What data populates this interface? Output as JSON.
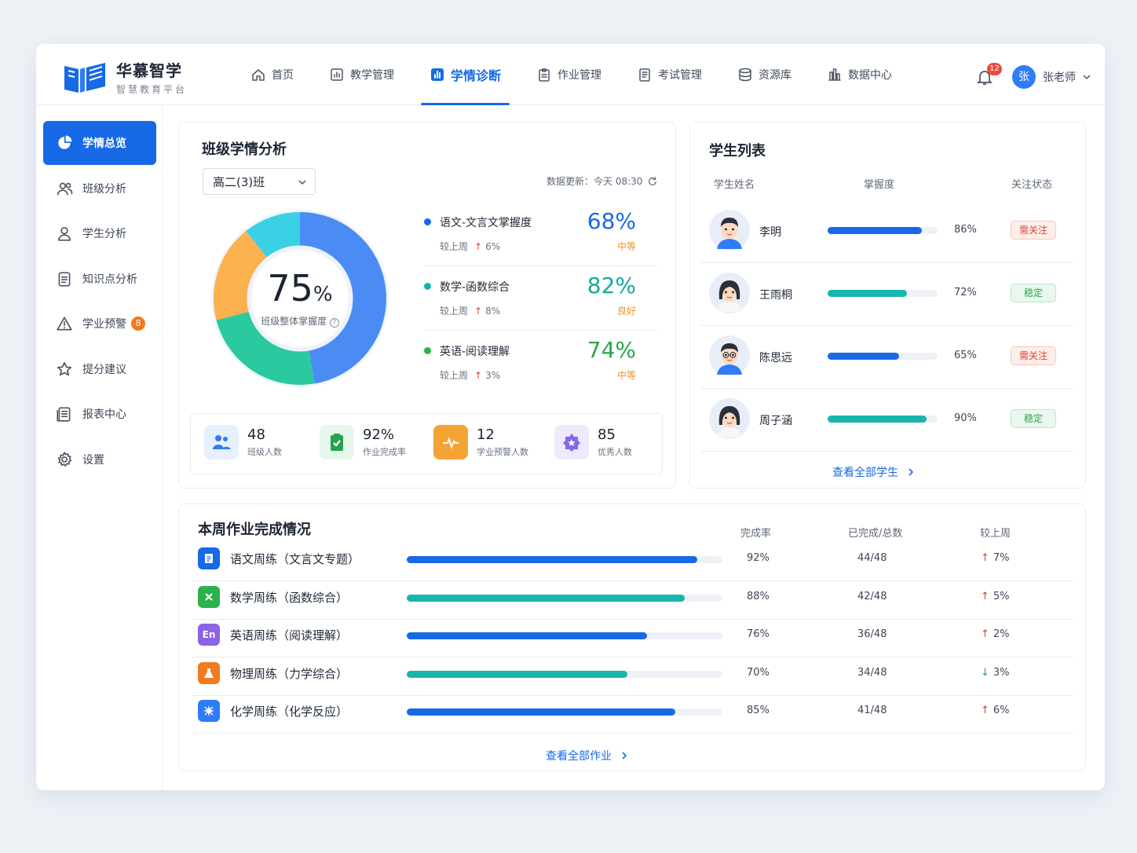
{
  "brand": {
    "title": "华慕智学",
    "subtitle": "智慧教育平台"
  },
  "nav": [
    {
      "label": "首页",
      "icon": "home-icon"
    },
    {
      "label": "教学管理",
      "icon": "chart-board-icon"
    },
    {
      "label": "学情诊断",
      "icon": "bar-chart-icon",
      "active": true
    },
    {
      "label": "作业管理",
      "icon": "clipboard-icon"
    },
    {
      "label": "考试管理",
      "icon": "exam-icon"
    },
    {
      "label": "资源库",
      "icon": "database-icon"
    },
    {
      "label": "数据中心",
      "icon": "columns-icon"
    }
  ],
  "notifications": {
    "count": "12"
  },
  "user": {
    "avatar_char": "张",
    "name": "张老师"
  },
  "sidebar": [
    {
      "label": "学情总览",
      "icon": "pie-icon",
      "active": true
    },
    {
      "label": "班级分析",
      "icon": "users-icon"
    },
    {
      "label": "学生分析",
      "icon": "user-icon"
    },
    {
      "label": "知识点分析",
      "icon": "document-icon"
    },
    {
      "label": "学业预警",
      "icon": "warning-icon",
      "badge": "8"
    },
    {
      "label": "提分建议",
      "icon": "star-outline-icon"
    },
    {
      "label": "报表中心",
      "icon": "report-icon"
    },
    {
      "label": "设置",
      "icon": "gear-icon"
    }
  ],
  "analysis": {
    "title": "班级学情分析",
    "class_select": "高二(3)班",
    "update_label": "数据更新：",
    "update_time": "今天 08:30",
    "overall_value": "75",
    "overall_unit": "%",
    "overall_label": "班级整体掌握度",
    "donut": [
      {
        "value": 44,
        "color": "#4a8cf4"
      },
      {
        "value": 22,
        "color": "#2bc9a0"
      },
      {
        "value": 17,
        "color": "#fbb14d"
      },
      {
        "value": 10,
        "color": "#3bd1e4"
      }
    ],
    "subjects": [
      {
        "name": "语文-文言文掌握度",
        "pct": "68%",
        "level": "中等",
        "delta_label": "较上周",
        "delta": "6%",
        "color": "#1769e6",
        "pct_color": "#1769e6",
        "level_color": "#f2951f"
      },
      {
        "name": "数学-函数综合",
        "pct": "82%",
        "level": "良好",
        "delta_label": "较上周",
        "delta": "8%",
        "color": "#13b4b0",
        "pct_color": "#13aa9a",
        "level_color": "#f2951f"
      },
      {
        "name": "英语-阅读理解",
        "pct": "74%",
        "level": "中等",
        "delta_label": "较上周",
        "delta": "3%",
        "color": "#28b44b",
        "pct_color": "#28a84a",
        "level_color": "#f2951f"
      }
    ],
    "stats": [
      {
        "value": "48",
        "label": "班级人数",
        "icon": "users-icon",
        "bg": "#e7f0fe",
        "fg": "#2f7cf6"
      },
      {
        "value": "92%",
        "label": "作业完成率",
        "icon": "clipboard-check-icon",
        "bg": "#e6f7ec",
        "fg": "#2aa34f"
      },
      {
        "value": "12",
        "label": "学业预警人数",
        "icon": "pulse-icon",
        "bg": "#fde9cc",
        "fg": "#f6a336"
      },
      {
        "value": "85",
        "label": "优秀人数",
        "icon": "star-badge-icon",
        "bg": "#eeeafd",
        "fg": "#8566ec"
      }
    ]
  },
  "students": {
    "title": "学生列表",
    "headers": {
      "name": "学生姓名",
      "mastery": "掌握度",
      "status": "关注状态"
    },
    "rows": [
      {
        "name": "李明",
        "mastery": 86,
        "pct": "86%",
        "status": "需关注",
        "type": "warn",
        "gender": "boy",
        "bar": "#1769e6"
      },
      {
        "name": "王雨桐",
        "mastery": 72,
        "pct": "72%",
        "status": "稳定",
        "type": "ok",
        "gender": "girl",
        "bar": "#19b5ad"
      },
      {
        "name": "陈思远",
        "mastery": 65,
        "pct": "65%",
        "status": "需关注",
        "type": "warn",
        "gender": "boy-glasses",
        "bar": "#1769e6"
      },
      {
        "name": "周子涵",
        "mastery": 90,
        "pct": "90%",
        "status": "稳定",
        "type": "ok",
        "gender": "girl2",
        "bar": "#19b5ad"
      }
    ],
    "view_all": "查看全部学生"
  },
  "homework": {
    "title": "本周作业完成情况",
    "headers": {
      "rate": "完成率",
      "count": "已完成/总数",
      "week": "较上周"
    },
    "rows": [
      {
        "name": "语文周练（文言文专题）",
        "rate_value": 92,
        "rate": "92%",
        "count": "44/48",
        "trend": "up",
        "change": "7%",
        "icon": "doc-icon",
        "color": "#1769e6",
        "bar": "#1769e6"
      },
      {
        "name": "数学周练（函数综合）",
        "rate_value": 88,
        "rate": "88%",
        "count": "42/48",
        "trend": "up",
        "change": "5%",
        "icon": "cross-icon",
        "color": "#2bb24c",
        "bar": "#19b5ad"
      },
      {
        "name": "英语周练（阅读理解）",
        "rate_value": 76,
        "rate": "76%",
        "count": "36/48",
        "trend": "up",
        "change": "2%",
        "icon": "english-icon",
        "icon_text": "En",
        "color": "#8b63e6",
        "bar": "#1769e6"
      },
      {
        "name": "物理周练（力学综合）",
        "rate_value": 70,
        "rate": "70%",
        "count": "34/48",
        "trend": "down",
        "change": "3%",
        "icon": "flask-icon",
        "color": "#f27a1f",
        "bar": "#19b5ad"
      },
      {
        "name": "化学周练（化学反应）",
        "rate_value": 85,
        "rate": "85%",
        "count": "41/48",
        "trend": "up",
        "change": "6%",
        "icon": "atom-icon",
        "color": "#2f7cf6",
        "bar": "#1769e6"
      }
    ],
    "view_all": "查看全部作业"
  }
}
